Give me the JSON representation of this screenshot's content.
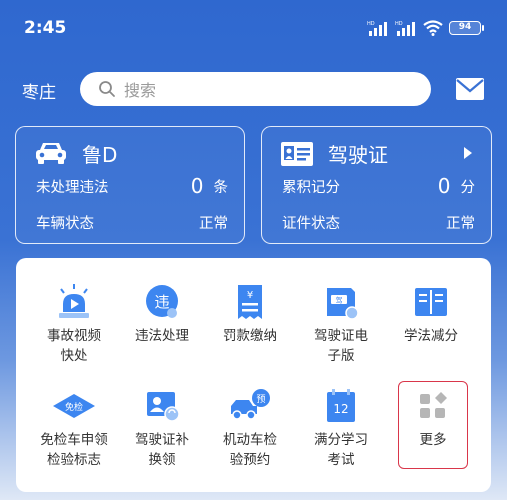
{
  "status_bar": {
    "time": "2:45",
    "battery": "94"
  },
  "header": {
    "city": "枣庄",
    "search_placeholder": "搜索"
  },
  "vehicle_card": {
    "title": "鲁D",
    "violations_label": "未处理违法",
    "violations_count": "0",
    "violations_unit": "条",
    "status_label": "车辆状态",
    "status_value": "正常"
  },
  "license_card": {
    "title": "驾驶证",
    "points_label": "累积记分",
    "points_count": "0",
    "points_unit": "分",
    "status_label": "证件状态",
    "status_value": "正常"
  },
  "services": [
    {
      "label": "事故视频\n快处",
      "icon": "alarm-light-icon"
    },
    {
      "label": "违法处理",
      "icon": "violation-icon"
    },
    {
      "label": "罚款缴纳",
      "icon": "fine-receipt-icon"
    },
    {
      "label": "驾驶证电\n子版",
      "icon": "e-license-icon"
    },
    {
      "label": "学法减分",
      "icon": "book-icon"
    },
    {
      "label": "免检车申领\n检验标志",
      "icon": "exemption-badge-icon"
    },
    {
      "label": "驾驶证补\n换领",
      "icon": "license-renew-icon"
    },
    {
      "label": "机动车检\n验预约",
      "icon": "inspection-booking-icon"
    },
    {
      "label": "满分学习\n考试",
      "icon": "calendar-exam-icon"
    },
    {
      "label": "更多",
      "icon": "more-grid-icon"
    }
  ],
  "colors": {
    "primary": "#2f68cf",
    "icon_blue": "#3d86f0",
    "highlight_border": "#d9364a"
  }
}
